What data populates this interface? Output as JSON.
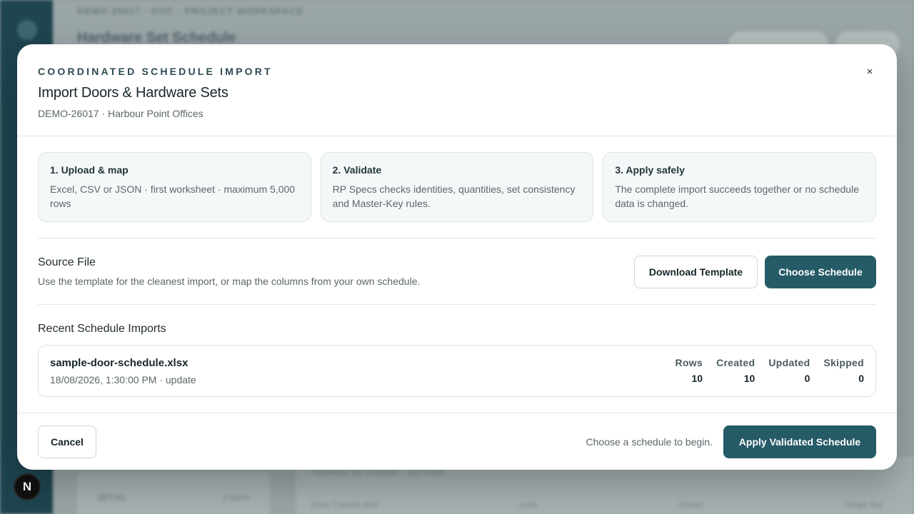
{
  "background": {
    "breadcrumb": "DEMO-26017 · DOC · PROJECT WORKSPACE",
    "page_title": "Hardware Set Schedule",
    "left_panel_item": "SET-01",
    "left_panel_value": "2 items",
    "main_panel_caption": "Hardware set schedule · Sort order",
    "main_panel_columns": [
      "Door Count/Label",
      "Lock",
      "Closer",
      "Hinge Set"
    ]
  },
  "avatar": {
    "letter": "N"
  },
  "modal": {
    "eyebrow": "COORDINATED SCHEDULE IMPORT",
    "title": "Import Doors & Hardware Sets",
    "subtitle": "DEMO-26017 · Harbour Point Offices",
    "close_label": "×",
    "steps": [
      {
        "title": "1. Upload & map",
        "desc": "Excel, CSV or JSON · first worksheet · maximum 5,000 rows"
      },
      {
        "title": "2. Validate",
        "desc": "RP Specs checks identities, quantities, set consistency and Master-Key rules."
      },
      {
        "title": "3. Apply safely",
        "desc": "The complete import succeeds together or no schedule data is changed."
      }
    ],
    "source": {
      "title": "Source File",
      "desc": "Use the template for the cleanest import, or map the columns from your own schedule.",
      "download_label": "Download Template",
      "choose_label": "Choose Schedule"
    },
    "recent": {
      "title": "Recent Schedule Imports",
      "items": [
        {
          "file": "sample-door-schedule.xlsx",
          "meta": "18/08/2026, 1:30:00 PM · update",
          "stats": [
            {
              "label": "Rows",
              "value": "10"
            },
            {
              "label": "Created",
              "value": "10"
            },
            {
              "label": "Updated",
              "value": "0"
            },
            {
              "label": "Skipped",
              "value": "0"
            }
          ]
        }
      ]
    },
    "footer": {
      "cancel_label": "Cancel",
      "status": "Choose a schedule to begin.",
      "apply_label": "Apply Validated Schedule"
    }
  },
  "colors": {
    "accent": "#255a67",
    "sidebar": "#1e4550"
  }
}
